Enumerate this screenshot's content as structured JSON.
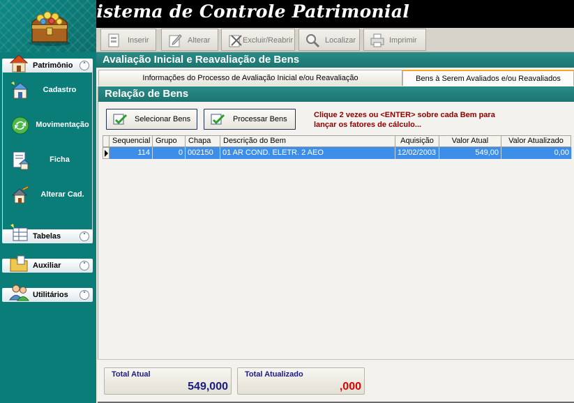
{
  "app": {
    "title": "Sistema de Controle Patrimonial"
  },
  "sidebar": {
    "patrimonio": {
      "label": "Patrimônio",
      "items": [
        {
          "label": "Cadastro"
        },
        {
          "label": "Movimentação"
        },
        {
          "label": "Ficha"
        },
        {
          "label": "Alterar Cad."
        }
      ]
    },
    "tabelas": {
      "label": "Tabelas"
    },
    "auxiliar": {
      "label": "Auxiliar"
    },
    "utilitarios": {
      "label": "Utilitários"
    }
  },
  "toolbar": {
    "inserir": "Inserir",
    "alterar": "Alterar",
    "excluir": "Excluir/Reabrir",
    "localizar": "Localizar",
    "imprimir": "Imprimir"
  },
  "form": {
    "title": "Avaliação Inicial e Reavaliação de Bens",
    "tabs": [
      {
        "label": "Informações do Processo de Avaliação Inicial e/ou Reavaliação"
      },
      {
        "label": "Bens à Serem Avaliados e/ou Reavaliados"
      }
    ]
  },
  "relacao": {
    "title": "Relação de Bens",
    "select_button": "Selecionar Bens",
    "process_button": "Processar Bens",
    "instruction_line1": "Clique 2 vezes ou <ENTER> sobre cada Bem para",
    "instruction_line2": "lançar os fatores de cálculo..."
  },
  "grid": {
    "columns": [
      "Sequencial",
      "Grupo",
      "Chapa",
      "Descrição do Bem",
      "Aquisição",
      "Valor Atual",
      "Valor Atualizado"
    ],
    "rows": [
      {
        "sequencial": "114",
        "grupo": "0",
        "chapa": "002150",
        "descricao": "01 AR COND. ELETR. 2 AEO",
        "aquisicao": "12/02/2003",
        "valor_atual": "549,00",
        "valor_atualizado": "0,00"
      }
    ]
  },
  "totals": {
    "total_atual_label": "Total Atual",
    "total_atual_value": "549,000",
    "total_atualizado_label": "Total Atualizado",
    "total_atualizado_value": ",000"
  },
  "colors": {
    "teal": "#0b7d79",
    "selection": "#3d8ee8",
    "instruction": "#8b0000",
    "total_atual": "#1a1a80",
    "total_atualizado": "#e00000"
  }
}
